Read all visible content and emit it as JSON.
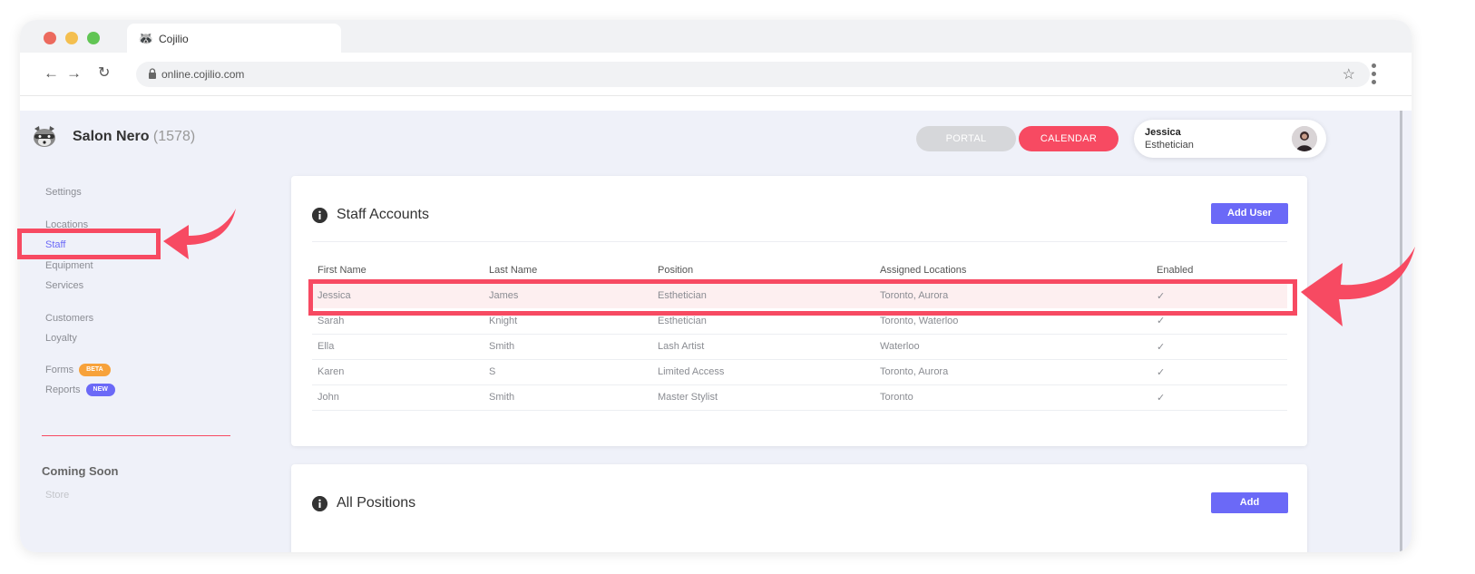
{
  "browser": {
    "tab_title": "Cojilio",
    "url": "online.cojilio.com"
  },
  "header": {
    "salon_name": "Salon Nero",
    "salon_id": "(1578)",
    "portal_label": "PORTAL",
    "calendar_label": "CALENDAR",
    "user": {
      "name": "Jessica",
      "role": "Esthetician"
    }
  },
  "sidebar": {
    "items": [
      {
        "label": "Settings"
      },
      {
        "label": "Locations"
      },
      {
        "label": "Staff"
      },
      {
        "label": "Equipment"
      },
      {
        "label": "Services"
      },
      {
        "label": "Customers"
      },
      {
        "label": "Loyalty"
      },
      {
        "label": "Forms",
        "badge": "BETA"
      },
      {
        "label": "Reports",
        "badge": "NEW"
      }
    ],
    "coming_soon": "Coming Soon",
    "coming_soon_items": [
      "Store"
    ]
  },
  "staff_accounts": {
    "title": "Staff Accounts",
    "add_button": "Add User",
    "columns": [
      "First Name",
      "Last Name",
      "Position",
      "Assigned Locations",
      "Enabled"
    ],
    "rows": [
      [
        "Jessica",
        "James",
        "Esthetician",
        "Toronto, Aurora",
        "✓"
      ],
      [
        "Sarah",
        "Knight",
        "Esthetician",
        "Toronto, Waterloo",
        "✓"
      ],
      [
        "Ella",
        "Smith",
        "Lash Artist",
        "Waterloo",
        "✓"
      ],
      [
        "Karen",
        "S",
        "Limited Access",
        "Toronto, Aurora",
        "✓"
      ],
      [
        "John",
        "Smith",
        "Master Stylist",
        "Toronto",
        "✓"
      ]
    ]
  },
  "all_positions": {
    "title": "All Positions",
    "add_button": "Add"
  },
  "colors": {
    "accent": "#6b69f7",
    "highlight": "#f74a62",
    "beta": "#f7a23b"
  }
}
